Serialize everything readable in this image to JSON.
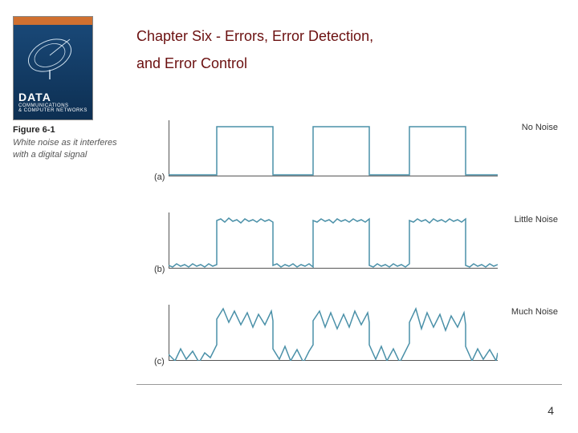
{
  "book_cover": {
    "title_big": "DATA",
    "title_mid": "COMMUNICATIONS",
    "title_small": "& COMPUTER NETWORKS"
  },
  "chapter_title_line1": "Chapter Six - Errors, Error Detection,",
  "chapter_title_line2": "and Error Control",
  "figure": {
    "number": "Figure 6-1",
    "description": "White noise as it interferes with a digital signal"
  },
  "rows": {
    "a": {
      "left": "(a)",
      "right": "No Noise"
    },
    "b": {
      "left": "(b)",
      "right": "Little Noise"
    },
    "c": {
      "left": "(c)",
      "right": "Much Noise"
    }
  },
  "page_number": "4"
}
